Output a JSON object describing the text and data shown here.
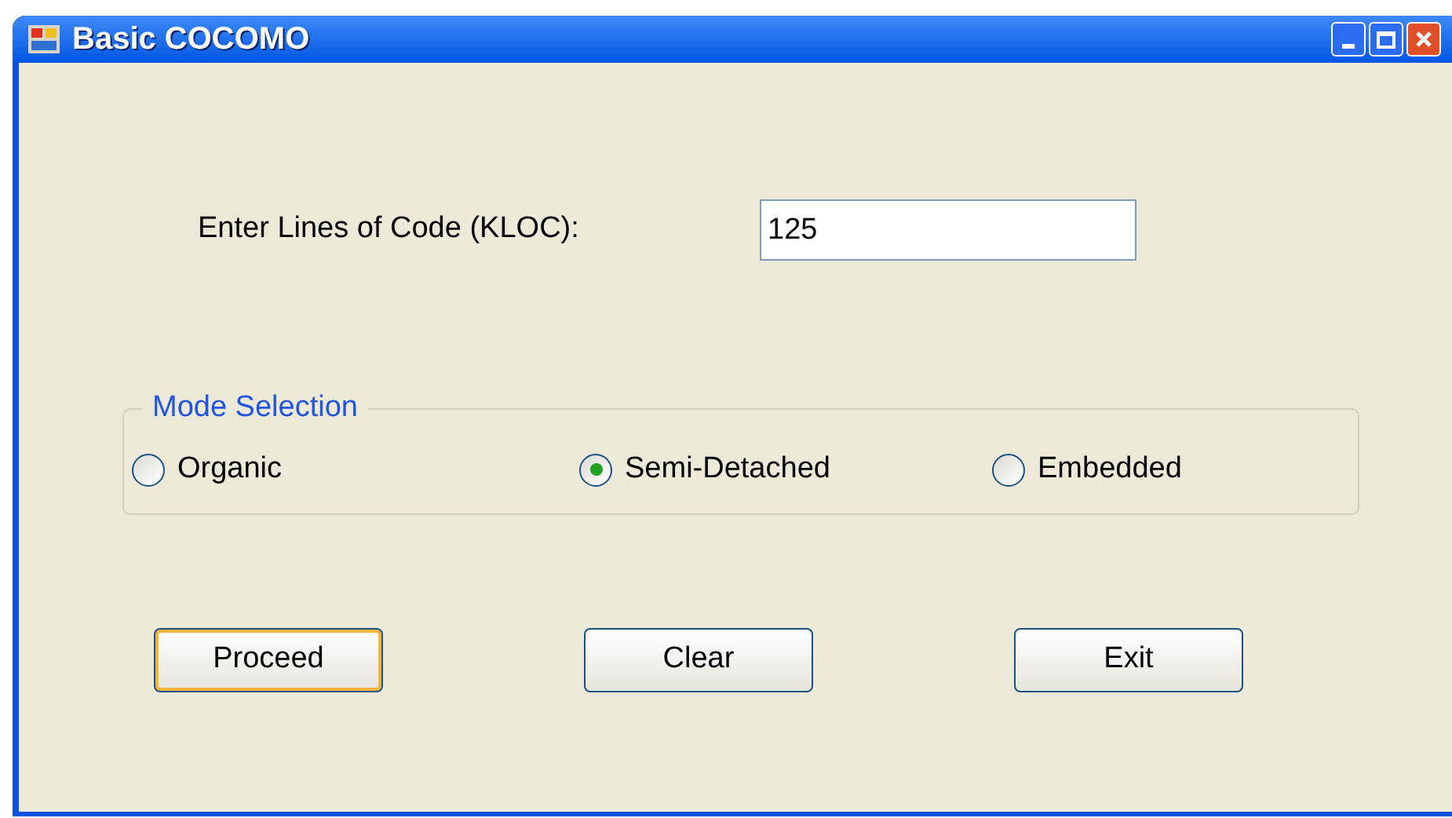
{
  "window": {
    "title": "Basic COCOMO"
  },
  "kloc": {
    "label": "Enter Lines of Code (KLOC):",
    "value": "125"
  },
  "mode_group": {
    "title": "Mode Selection",
    "options": [
      {
        "label": "Organic",
        "selected": false
      },
      {
        "label": "Semi-Detached",
        "selected": true
      },
      {
        "label": "Embedded",
        "selected": false
      }
    ]
  },
  "buttons": [
    {
      "label": "Proceed",
      "focused": true
    },
    {
      "label": "Clear",
      "focused": false
    },
    {
      "label": "Exit",
      "focused": false
    }
  ]
}
